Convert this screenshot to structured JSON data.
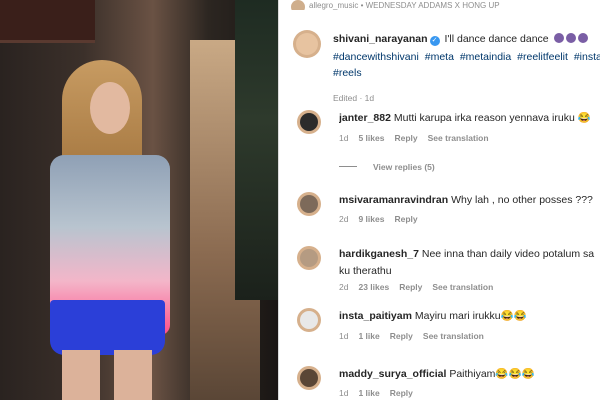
{
  "header": {
    "text": "allegro_music • WEDNESDAY ADDAMS X HONG UP"
  },
  "caption": {
    "username": "shivani_narayanan",
    "verified": true,
    "text": "I'll dance dance dance",
    "tags": [
      "#dancewithshivani",
      "#meta",
      "#metaindia",
      "#reelitfeelit",
      "#instag",
      "#reels"
    ],
    "edited": "Edited · 1d"
  },
  "comments": [
    {
      "username": "janter_882",
      "text": "Mutti karupa irka reason yennava iruku 😂",
      "line2": "",
      "time": "1d",
      "likes": "5 likes",
      "reply": "Reply",
      "translate": "See translation",
      "view_replies": "View replies (5)",
      "avatar_color": "#2b2b2b"
    },
    {
      "username": "msivaramanravindran",
      "text": "Why lah , no other posses ???",
      "line2": "",
      "time": "2d",
      "likes": "9 likes",
      "reply": "Reply",
      "translate": "",
      "view_replies": "",
      "avatar_color": "#7d6a5a"
    },
    {
      "username": "hardikganesh_7",
      "text": "Nee inna than daily video potalum sa",
      "line2": "ku therathu",
      "time": "2d",
      "likes": "23 likes",
      "reply": "Reply",
      "translate": "See translation",
      "view_replies": "",
      "avatar_color": "#b59b82"
    },
    {
      "username": "insta_paitiyam",
      "text": "Mayiru mari irukku😂😂",
      "line2": "",
      "time": "1d",
      "likes": "1 like",
      "reply": "Reply",
      "translate": "See translation",
      "view_replies": "",
      "avatar_color": "#e8e8e8"
    },
    {
      "username": "maddy_surya_official",
      "text": "Paithiyam😂😂😂",
      "line2": "",
      "time": "1d",
      "likes": "1 like",
      "reply": "Reply",
      "translate": "",
      "view_replies": "",
      "avatar_color": "#5a4636"
    }
  ],
  "colors": {
    "link": "#00376b",
    "muted": "#8e8e8e",
    "verified": "#3897f0"
  }
}
